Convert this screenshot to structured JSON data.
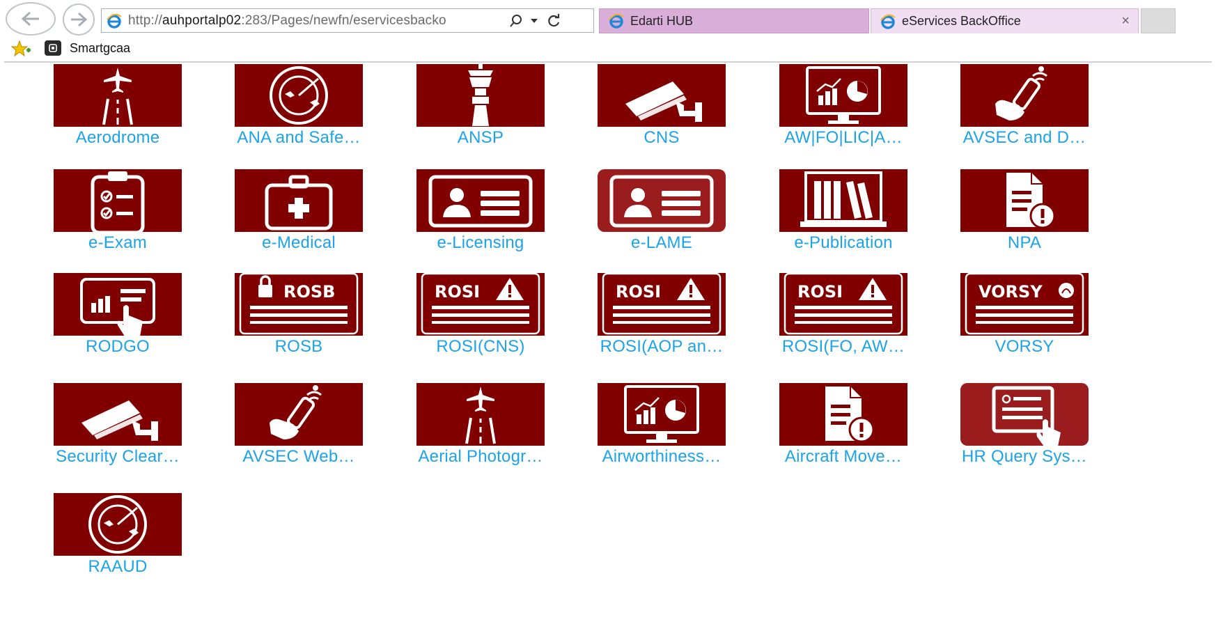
{
  "browser": {
    "address_host": "http://",
    "address_bold": "auhportalp02",
    "address_rest": ":283/Pages/newfn/eservicesbacko",
    "tabs": [
      {
        "label": "Edarti HUB"
      },
      {
        "label": "eServices BackOffice"
      }
    ],
    "close_glyph": "×",
    "favorites": [
      {
        "label": "Smartgcaa"
      }
    ]
  },
  "colors": {
    "tile_bg": "#800000",
    "tile_highlight_bg": "#9a1c1c",
    "label": "#1ca3ea",
    "tab_active": "#d9aed9"
  },
  "tiles": [
    {
      "label": "Aerodrome",
      "icon": "runway-plane-icon"
    },
    {
      "label": "ANA and Safe…",
      "icon": "radar-icon"
    },
    {
      "label": "ANSP",
      "icon": "control-tower-icon"
    },
    {
      "label": "CNS",
      "icon": "security-camera-icon"
    },
    {
      "label": "AW|FO|LIC|A…",
      "icon": "monitor-chart-icon"
    },
    {
      "label": "AVSEC and D…",
      "icon": "hand-scanner-icon"
    },
    {
      "label": "e-Exam",
      "icon": "clipboard-checklist-icon"
    },
    {
      "label": "e-Medical",
      "icon": "medical-kit-icon"
    },
    {
      "label": "e-Licensing",
      "icon": "id-card-icon"
    },
    {
      "label": "e-LAME",
      "icon": "id-card-icon",
      "highlight": true
    },
    {
      "label": "e-Publication",
      "icon": "bookshelf-icon"
    },
    {
      "label": "NPA",
      "icon": "document-alert-icon"
    },
    {
      "label": "RODGO",
      "icon": "tablet-touch-icon"
    },
    {
      "label": "ROSB",
      "icon": "lock-form-icon",
      "badge": "ROSB"
    },
    {
      "label": "ROSI(CNS)",
      "icon": "warning-form-icon",
      "badge": "ROSI"
    },
    {
      "label": "ROSI(AOP an…",
      "icon": "warning-form-icon",
      "badge": "ROSI"
    },
    {
      "label": "ROSI(FO, AW…",
      "icon": "warning-form-icon",
      "badge": "ROSI"
    },
    {
      "label": "VORSY",
      "icon": "vorsy-form-icon",
      "badge": "VORSY"
    },
    {
      "label": "Security Clear…",
      "icon": "security-camera-icon"
    },
    {
      "label": "AVSEC Web…",
      "icon": "hand-scanner-icon"
    },
    {
      "label": "Aerial Photogr…",
      "icon": "runway-plane-icon"
    },
    {
      "label": "Airworthiness…",
      "icon": "monitor-chart-icon"
    },
    {
      "label": "Aircraft Move…",
      "icon": "document-alert-icon"
    },
    {
      "label": "HR Query Sys…",
      "icon": "hand-document-icon",
      "highlight": true
    },
    {
      "label": "RAAUD",
      "icon": "radar-icon"
    }
  ]
}
